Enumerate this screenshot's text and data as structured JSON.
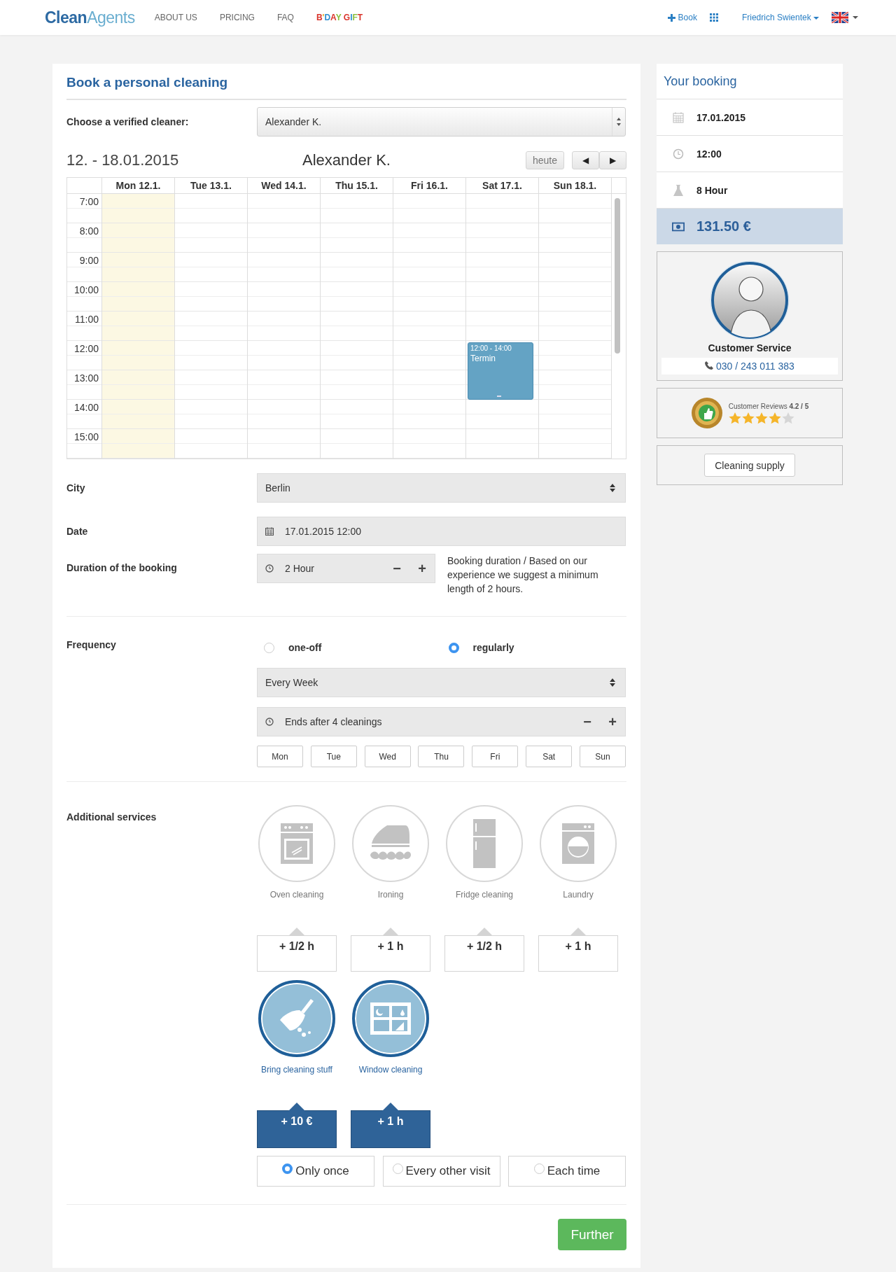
{
  "nav": {
    "logo": {
      "first": "Clean",
      "second": "Agents"
    },
    "links": [
      "ABOUT US",
      "PRICING",
      "FAQ"
    ],
    "gift": "B'DAY GIFT",
    "book": "Book",
    "user": "Friedrich Swientek"
  },
  "booking": {
    "title": "Book a personal cleaning",
    "cleaner_label": "Choose a verified cleaner:",
    "cleaner": "Alexander K.",
    "calendar": {
      "range": "12. - 18.01.2015",
      "name": "Alexander K.",
      "today_button": "heute",
      "prev": "◀",
      "next": "▶",
      "days": [
        {
          "label": "Mon 12.1.",
          "today": true
        },
        {
          "label": "Tue 13.1.",
          "today": false
        },
        {
          "label": "Wed 14.1.",
          "today": false
        },
        {
          "label": "Thu 15.1.",
          "today": false
        },
        {
          "label": "Fri 16.1.",
          "today": false
        },
        {
          "label": "Sat 17.1.",
          "today": false,
          "events": [
            {
              "time": "12:00 - 14:00",
              "title": "Termin"
            }
          ]
        },
        {
          "label": "Sun 18.1.",
          "today": false
        }
      ],
      "hours": [
        "7:00",
        "8:00",
        "9:00",
        "10:00",
        "11:00",
        "12:00",
        "13:00",
        "14:00",
        "15:00"
      ]
    },
    "city": {
      "label": "City",
      "value": "Berlin"
    },
    "date": {
      "label": "Date",
      "value": "17.01.2015 12:00"
    },
    "duration": {
      "label": "Duration of the booking",
      "value": "2 Hour",
      "minus": "−",
      "plus": "+",
      "hint": "Booking duration / Based on our experience we suggest a minimum length of 2 hours."
    },
    "frequency": {
      "label": "Frequency",
      "options": [
        {
          "label": "one-off",
          "selected": false
        },
        {
          "label": "regularly",
          "selected": true
        }
      ],
      "interval": "Every Week",
      "ends": "Ends after 4 cleanings",
      "minus": "−",
      "plus": "+",
      "weekdays": [
        {
          "label": "Mon",
          "selected": false
        },
        {
          "label": "Tue",
          "selected": false
        },
        {
          "label": "Wed",
          "selected": false
        },
        {
          "label": "Thu",
          "selected": false
        },
        {
          "label": "Fri",
          "selected": false
        },
        {
          "label": "Sat",
          "selected": false
        },
        {
          "label": "Sun",
          "selected": false
        }
      ]
    },
    "services": {
      "label": "Additional services",
      "items": [
        {
          "kind": "oven",
          "label": "Oven cleaning",
          "extra": "+ 1/2 h",
          "selected": false
        },
        {
          "kind": "iron",
          "label": "Ironing",
          "extra": "+ 1 h",
          "selected": false
        },
        {
          "kind": "fridge",
          "label": "Fridge cleaning",
          "extra": "+ 1/2 h",
          "selected": false
        },
        {
          "kind": "laundry",
          "label": "Laundry",
          "extra": "+ 1 h",
          "selected": false
        },
        {
          "kind": "broom",
          "label": "Bring cleaning stuff",
          "extra": "+ 10 €",
          "selected": true
        },
        {
          "kind": "window",
          "label": "Window cleaning",
          "extra": "+ 1 h",
          "selected": true
        }
      ],
      "repeat": [
        {
          "label": "Only once",
          "selected": true
        },
        {
          "label": "Every other visit",
          "selected": false
        },
        {
          "label": "Each time",
          "selected": false
        }
      ]
    },
    "further": "Further"
  },
  "sidebar": {
    "title": "Your booking",
    "rows": [
      {
        "kind": "date",
        "value": "17.01.2015"
      },
      {
        "kind": "time",
        "value": "12:00"
      },
      {
        "kind": "duration",
        "value": "8 Hour"
      },
      {
        "kind": "price",
        "value": "131.50 €"
      }
    ],
    "service": {
      "title": "Customer Service",
      "phone": "030 / 243 011 383"
    },
    "reviews": {
      "text": "Customer Reviews **4.2 / 5**",
      "stars": 4
    },
    "supply": "Cleaning supply"
  }
}
